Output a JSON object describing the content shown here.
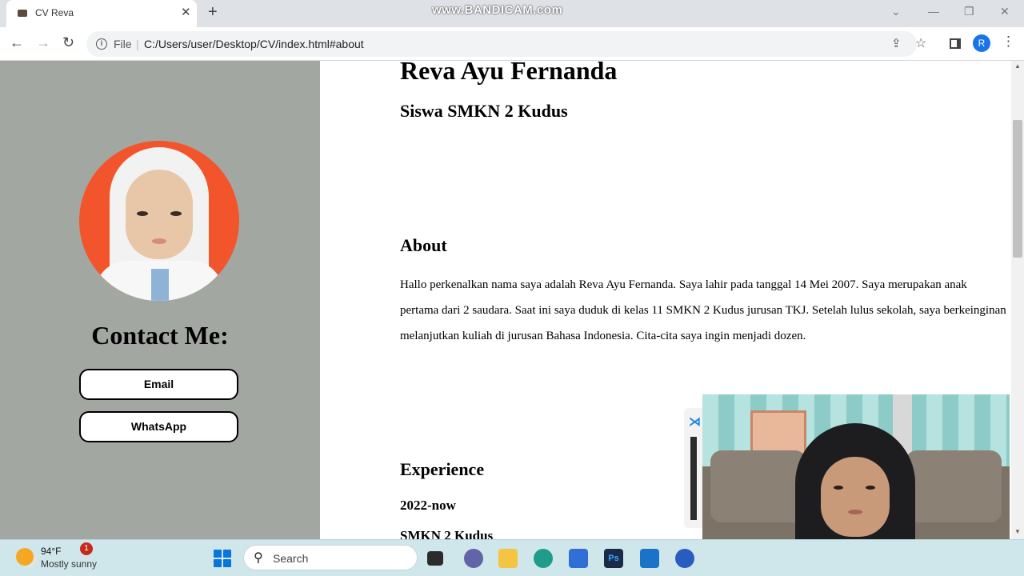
{
  "browser": {
    "tab_title": "CV Reva",
    "new_tab": "+",
    "tab_close": "✕",
    "watermark": "www.BANDICAM.com",
    "file_label": "File",
    "url": "C:/Users/user/Desktop/CV/index.html#about",
    "profile_initial": "R"
  },
  "sidebar": {
    "contact_title": "Contact Me:",
    "buttons": [
      "Email",
      "WhatsApp"
    ]
  },
  "main": {
    "name": "Reva Ayu Fernanda",
    "role": "Siswa SMKN 2 Kudus",
    "about_heading": "About",
    "about_text": "Hallo perkenalkan nama saya adalah Reva Ayu Fernanda. Saya lahir pada tanggal 14 Mei 2007. Saya merupakan anak pertama dari 2 saudara. Saat ini saya duduk di kelas 11 SMKN 2 Kudus jurusan TKJ. Setelah lulus sekolah, saya berkeinginan melanjutkan kuliah di jurusan Bahasa Indonesia. Cita-cita saya ingin menjadi dozen.",
    "experience_heading": "Experience",
    "experience_year": "2022-now",
    "experience_school": "SMKN 2 Kudus"
  },
  "taskbar": {
    "temperature": "94°F",
    "weather": "Mostly sunny",
    "notification_count": "1",
    "search_placeholder": "Search"
  },
  "colors": {
    "sidebar_bg": "#a3a7a1",
    "photo_bg": "#f2552c",
    "taskbar_bg": "#cfe6ea"
  }
}
